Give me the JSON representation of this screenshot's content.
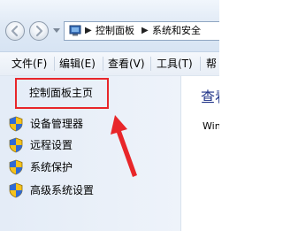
{
  "address_bar": {
    "segments": [
      "控制面板",
      "系统和安全"
    ]
  },
  "menu": {
    "items": [
      "文件(F)",
      "编辑(E)",
      "查看(V)",
      "工具(T)",
      "帮"
    ]
  },
  "sidebar": {
    "home_link": "控制面板主页",
    "items": [
      {
        "label": "设备管理器",
        "icon": "shield-icon"
      },
      {
        "label": "远程设置",
        "icon": "shield-icon"
      },
      {
        "label": "系统保护",
        "icon": "shield-icon"
      },
      {
        "label": "高级系统设置",
        "icon": "shield-icon"
      }
    ]
  },
  "content": {
    "title": "查看",
    "text": "Win"
  },
  "colors": {
    "highlight": "#e8262a",
    "title": "#1e3287"
  }
}
